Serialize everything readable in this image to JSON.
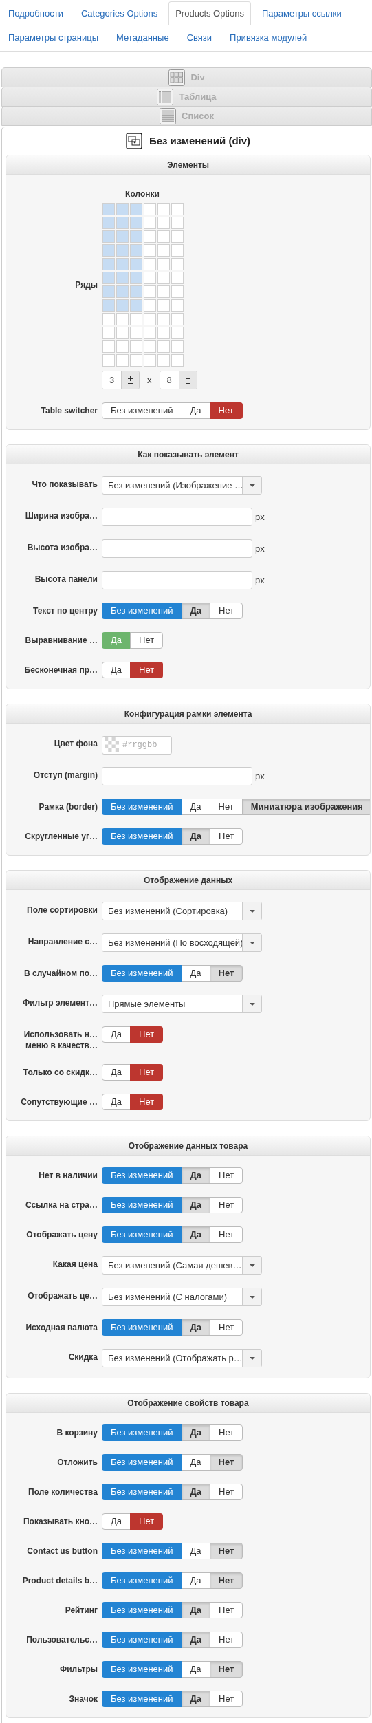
{
  "tab_rows": [
    {
      "tabs": [
        {
          "label": "Подробности",
          "selected": false
        },
        {
          "label": "Categories Options",
          "selected": false
        },
        {
          "label": "Products Options",
          "selected": true
        },
        {
          "label": "Параметры ссылки",
          "selected": false
        }
      ]
    },
    {
      "tabs": [
        {
          "label": "Параметры страницы",
          "selected": false
        },
        {
          "label": "Метаданные",
          "selected": false
        },
        {
          "label": "Связи",
          "selected": false
        },
        {
          "label": "Привязка модулей",
          "selected": false
        }
      ]
    }
  ],
  "accordion": [
    {
      "label": "Div",
      "kind": "div"
    },
    {
      "label": "Таблица",
      "kind": "table"
    },
    {
      "label": "Список",
      "kind": "list"
    }
  ],
  "panel": {
    "title": "Без изменений (div)",
    "sections": [
      {
        "title": "Элементы",
        "columns_label": "Колонки",
        "rows_label": "Ряды",
        "times": "x",
        "steppers": [
          "3",
          "8"
        ],
        "grid": [
          [
            true,
            true,
            true,
            false,
            false,
            false
          ],
          [
            true,
            true,
            true,
            false,
            false,
            false
          ],
          [
            true,
            true,
            true,
            false,
            false,
            false
          ],
          [
            true,
            true,
            true,
            false,
            false,
            false
          ],
          [
            true,
            true,
            true,
            false,
            false,
            false
          ],
          [
            true,
            true,
            true,
            false,
            false,
            false
          ],
          [
            true,
            true,
            true,
            false,
            false,
            false
          ],
          [
            true,
            true,
            true,
            false,
            false,
            false
          ],
          [
            false,
            false,
            false,
            false,
            false,
            false
          ],
          [
            false,
            false,
            false,
            false,
            false,
            false
          ],
          [
            false,
            false,
            false,
            false,
            false,
            false
          ],
          [
            false,
            false,
            false,
            false,
            false,
            false
          ]
        ],
        "rows": [
          {
            "kind": "toggle",
            "label": "Table switcher",
            "color": "#bd362f",
            "options": [
              {
                "label": "Без изменений",
                "selected": false,
                "inherited": false
              },
              {
                "label": "Да",
                "selected": false,
                "inherited": false
              },
              {
                "label": "Нет",
                "selected": true,
                "inherited": false
              }
            ]
          }
        ]
      },
      {
        "title": "Как показывать элемент",
        "rows": [
          {
            "kind": "select",
            "label": "Что показывать",
            "value": "Без изменений (Изображение …"
          },
          {
            "kind": "text",
            "label": "Ширина изобра…",
            "suffix": "px"
          },
          {
            "kind": "text",
            "label": "Высота изобра…",
            "suffix": "px"
          },
          {
            "kind": "text",
            "label": "Высота панели",
            "suffix": "px"
          },
          {
            "kind": "toggle",
            "label": "Текст по центру",
            "color": "#2384d3",
            "options": [
              {
                "label": "Без изменений",
                "selected": true,
                "inherited": false
              },
              {
                "label": "Да",
                "selected": false,
                "inherited": true
              },
              {
                "label": "Нет",
                "selected": false,
                "inherited": false
              }
            ]
          },
          {
            "kind": "toggle",
            "label": "Выравнивание …",
            "color": "#6db56d",
            "options": [
              {
                "label": "Да",
                "selected": true,
                "inherited": false
              },
              {
                "label": "Нет",
                "selected": false,
                "inherited": false
              }
            ]
          },
          {
            "kind": "toggle",
            "label": "Бесконечная пр…",
            "color": "#bd362f",
            "options": [
              {
                "label": "Да",
                "selected": false,
                "inherited": false
              },
              {
                "label": "Нет",
                "selected": true,
                "inherited": false
              }
            ]
          }
        ]
      },
      {
        "title": "Конфигурация рамки элемента",
        "rows": [
          {
            "kind": "color",
            "label": "Цвет фона",
            "placeholder": "#rrggbb"
          },
          {
            "kind": "text",
            "label": "Отступ (margin)",
            "suffix": "px"
          },
          {
            "kind": "toggle",
            "label": "Рамка (border)",
            "color": "#2384d3",
            "options": [
              {
                "label": "Без изменений",
                "selected": true,
                "inherited": false
              },
              {
                "label": "Да",
                "selected": false,
                "inherited": false
              },
              {
                "label": "Нет",
                "selected": false,
                "inherited": false
              },
              {
                "label": "Миниатюра изображения",
                "selected": false,
                "inherited": true
              }
            ]
          },
          {
            "kind": "toggle",
            "label": "Скругленные уг…",
            "color": "#2384d3",
            "options": [
              {
                "label": "Без изменений",
                "selected": true,
                "inherited": false
              },
              {
                "label": "Да",
                "selected": false,
                "inherited": true
              },
              {
                "label": "Нет",
                "selected": false,
                "inherited": false
              }
            ]
          }
        ]
      },
      {
        "title": "Отображение данных",
        "rows": [
          {
            "kind": "select",
            "label": "Поле сортировки",
            "value": "Без изменений (Сортировка)"
          },
          {
            "kind": "select",
            "label": "Направление с…",
            "value": "Без изменений (По восходящей)"
          },
          {
            "kind": "toggle",
            "label": "В случайном по…",
            "color": "#2384d3",
            "options": [
              {
                "label": "Без изменений",
                "selected": true,
                "inherited": false
              },
              {
                "label": "Да",
                "selected": false,
                "inherited": false
              },
              {
                "label": "Нет",
                "selected": false,
                "inherited": true
              }
            ]
          },
          {
            "kind": "select",
            "label": "Фильтр элемент…",
            "value": "Прямые элементы"
          },
          {
            "kind": "toggle",
            "label_lines": [
              "Использовать н…",
              "меню в качеств…"
            ],
            "color": "#bd362f",
            "options": [
              {
                "label": "Да",
                "selected": false,
                "inherited": false
              },
              {
                "label": "Нет",
                "selected": true,
                "inherited": false
              }
            ]
          },
          {
            "kind": "toggle",
            "label": "Только со скидк…",
            "color": "#bd362f",
            "options": [
              {
                "label": "Да",
                "selected": false,
                "inherited": false
              },
              {
                "label": "Нет",
                "selected": true,
                "inherited": false
              }
            ]
          },
          {
            "kind": "toggle",
            "label": "Сопутствующие …",
            "color": "#bd362f",
            "options": [
              {
                "label": "Да",
                "selected": false,
                "inherited": false
              },
              {
                "label": "Нет",
                "selected": true,
                "inherited": false
              }
            ]
          }
        ]
      },
      {
        "title": "Отображение данных товара",
        "rows": [
          {
            "kind": "toggle",
            "label": "Нет в наличии",
            "color": "#2384d3",
            "options": [
              {
                "label": "Без изменений",
                "selected": true,
                "inherited": false
              },
              {
                "label": "Да",
                "selected": false,
                "inherited": true
              },
              {
                "label": "Нет",
                "selected": false,
                "inherited": false
              }
            ]
          },
          {
            "kind": "toggle",
            "label": "Ссылка на стра…",
            "color": "#2384d3",
            "options": [
              {
                "label": "Без изменений",
                "selected": true,
                "inherited": false
              },
              {
                "label": "Да",
                "selected": false,
                "inherited": true
              },
              {
                "label": "Нет",
                "selected": false,
                "inherited": false
              }
            ]
          },
          {
            "kind": "toggle",
            "label": "Отображать цену",
            "color": "#2384d3",
            "options": [
              {
                "label": "Без изменений",
                "selected": true,
                "inherited": false
              },
              {
                "label": "Да",
                "selected": false,
                "inherited": true
              },
              {
                "label": "Нет",
                "selected": false,
                "inherited": false
              }
            ]
          },
          {
            "kind": "select",
            "label": "Какая цена",
            "value": "Без изменений (Самая дешев…"
          },
          {
            "kind": "select",
            "label": "Отображать це…",
            "value": "Без изменений (С налогами)"
          },
          {
            "kind": "toggle",
            "label": "Исходная валюта",
            "color": "#2384d3",
            "options": [
              {
                "label": "Без изменений",
                "selected": true,
                "inherited": false
              },
              {
                "label": "Да",
                "selected": false,
                "inherited": true
              },
              {
                "label": "Нет",
                "selected": false,
                "inherited": false
              }
            ]
          },
          {
            "kind": "select",
            "label": "Скидка",
            "value": "Без изменений (Отображать р…"
          }
        ]
      },
      {
        "title": "Отображение свойств товара",
        "rows": [
          {
            "kind": "toggle",
            "label": "В корзину",
            "color": "#2384d3",
            "options": [
              {
                "label": "Без изменений",
                "selected": true,
                "inherited": false
              },
              {
                "label": "Да",
                "selected": false,
                "inherited": true
              },
              {
                "label": "Нет",
                "selected": false,
                "inherited": false
              }
            ]
          },
          {
            "kind": "toggle",
            "label": "Отложить",
            "color": "#2384d3",
            "options": [
              {
                "label": "Без изменений",
                "selected": true,
                "inherited": false
              },
              {
                "label": "Да",
                "selected": false,
                "inherited": false
              },
              {
                "label": "Нет",
                "selected": false,
                "inherited": true
              }
            ]
          },
          {
            "kind": "toggle",
            "label": "Поле количества",
            "color": "#2384d3",
            "options": [
              {
                "label": "Без изменений",
                "selected": true,
                "inherited": false
              },
              {
                "label": "Да",
                "selected": false,
                "inherited": true
              },
              {
                "label": "Нет",
                "selected": false,
                "inherited": false
              }
            ]
          },
          {
            "kind": "toggle",
            "label": "Показывать кно…",
            "color": "#bd362f",
            "options": [
              {
                "label": "Да",
                "selected": false,
                "inherited": false
              },
              {
                "label": "Нет",
                "selected": true,
                "inherited": false
              }
            ]
          },
          {
            "kind": "toggle",
            "label": "Contact us button",
            "color": "#2384d3",
            "options": [
              {
                "label": "Без изменений",
                "selected": true,
                "inherited": false
              },
              {
                "label": "Да",
                "selected": false,
                "inherited": false
              },
              {
                "label": "Нет",
                "selected": false,
                "inherited": true
              }
            ]
          },
          {
            "kind": "toggle",
            "label": "Product details b…",
            "color": "#2384d3",
            "options": [
              {
                "label": "Без изменений",
                "selected": true,
                "inherited": false
              },
              {
                "label": "Да",
                "selected": false,
                "inherited": false
              },
              {
                "label": "Нет",
                "selected": false,
                "inherited": true
              }
            ]
          },
          {
            "kind": "toggle",
            "label": "Рейтинг",
            "color": "#2384d3",
            "options": [
              {
                "label": "Без изменений",
                "selected": true,
                "inherited": false
              },
              {
                "label": "Да",
                "selected": false,
                "inherited": true
              },
              {
                "label": "Нет",
                "selected": false,
                "inherited": false
              }
            ]
          },
          {
            "kind": "toggle",
            "label": "Пользовательс…",
            "color": "#2384d3",
            "options": [
              {
                "label": "Без изменений",
                "selected": true,
                "inherited": false
              },
              {
                "label": "Да",
                "selected": false,
                "inherited": true
              },
              {
                "label": "Нет",
                "selected": false,
                "inherited": false
              }
            ]
          },
          {
            "kind": "toggle",
            "label": "Фильтры",
            "color": "#2384d3",
            "options": [
              {
                "label": "Без изменений",
                "selected": true,
                "inherited": false
              },
              {
                "label": "Да",
                "selected": false,
                "inherited": false
              },
              {
                "label": "Нет",
                "selected": false,
                "inherited": true
              }
            ]
          },
          {
            "kind": "toggle",
            "label": "Значок",
            "color": "#2384d3",
            "options": [
              {
                "label": "Без изменений",
                "selected": true,
                "inherited": false
              },
              {
                "label": "Да",
                "selected": false,
                "inherited": true
              },
              {
                "label": "Нет",
                "selected": false,
                "inherited": false
              }
            ]
          }
        ]
      }
    ]
  }
}
